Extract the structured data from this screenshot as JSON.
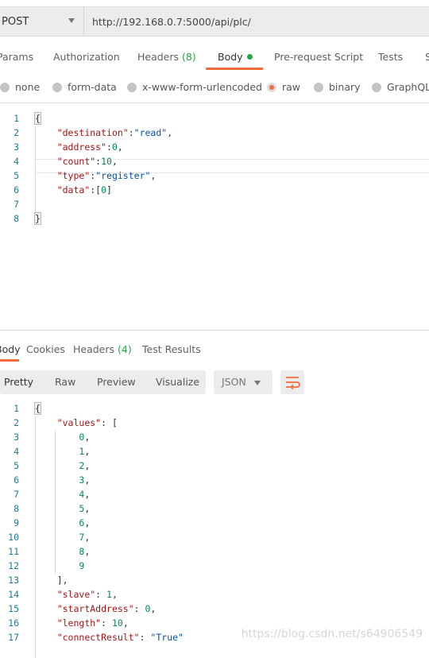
{
  "request": {
    "method": "POST",
    "url": "http://192.168.0.7:5000/api/plc/",
    "tabs": [
      {
        "label": "Params"
      },
      {
        "label": "Authorization"
      },
      {
        "label": "Headers",
        "count": "(8)"
      },
      {
        "label": "Body",
        "active": true
      },
      {
        "label": "Pre-request Script"
      },
      {
        "label": "Tests"
      },
      {
        "label": "S"
      }
    ],
    "body_types": [
      {
        "label": "none"
      },
      {
        "label": "form-data"
      },
      {
        "label": "x-www-form-urlencoded"
      },
      {
        "label": "raw",
        "selected": true
      },
      {
        "label": "binary"
      },
      {
        "label": "GraphQL"
      }
    ],
    "code_lines": [
      [
        [
          "p",
          "{"
        ]
      ],
      [
        [
          "p",
          "    "
        ],
        [
          "k",
          "\"destination\""
        ],
        [
          "p",
          ":"
        ],
        [
          "s",
          "\"read\""
        ],
        [
          "p",
          ","
        ]
      ],
      [
        [
          "p",
          "    "
        ],
        [
          "k",
          "\"address\""
        ],
        [
          "p",
          ":"
        ],
        [
          "n",
          "0"
        ],
        [
          "p",
          ","
        ]
      ],
      [
        [
          "p",
          "    "
        ],
        [
          "k",
          "\"count\""
        ],
        [
          "p",
          ":"
        ],
        [
          "n",
          "10"
        ],
        [
          "p",
          ","
        ]
      ],
      [
        [
          "p",
          "    "
        ],
        [
          "k",
          "\"type\""
        ],
        [
          "p",
          ":"
        ],
        [
          "s",
          "\"register\""
        ],
        [
          "p",
          ","
        ]
      ],
      [
        [
          "p",
          "    "
        ],
        [
          "k",
          "\"data\""
        ],
        [
          "p",
          ":["
        ],
        [
          "n",
          "0"
        ],
        [
          "p",
          "]"
        ]
      ],
      [],
      [
        [
          "p",
          "}"
        ]
      ]
    ]
  },
  "response": {
    "tabs": [
      {
        "label": "Body",
        "active": true
      },
      {
        "label": "Cookies"
      },
      {
        "label": "Headers",
        "count": "(4)"
      },
      {
        "label": "Test Results"
      }
    ],
    "view_modes": [
      "Pretty",
      "Raw",
      "Preview",
      "Visualize"
    ],
    "format": "JSON",
    "wrap_icon": "wrap-lines-icon",
    "code_lines": [
      [
        [
          "p",
          "{"
        ]
      ],
      [
        [
          "p",
          "    "
        ],
        [
          "k",
          "\"values\""
        ],
        [
          "p",
          ": ["
        ]
      ],
      [
        [
          "p",
          "        "
        ],
        [
          "n",
          "0"
        ],
        [
          "p",
          ","
        ]
      ],
      [
        [
          "p",
          "        "
        ],
        [
          "n",
          "1"
        ],
        [
          "p",
          ","
        ]
      ],
      [
        [
          "p",
          "        "
        ],
        [
          "n",
          "2"
        ],
        [
          "p",
          ","
        ]
      ],
      [
        [
          "p",
          "        "
        ],
        [
          "n",
          "3"
        ],
        [
          "p",
          ","
        ]
      ],
      [
        [
          "p",
          "        "
        ],
        [
          "n",
          "4"
        ],
        [
          "p",
          ","
        ]
      ],
      [
        [
          "p",
          "        "
        ],
        [
          "n",
          "5"
        ],
        [
          "p",
          ","
        ]
      ],
      [
        [
          "p",
          "        "
        ],
        [
          "n",
          "6"
        ],
        [
          "p",
          ","
        ]
      ],
      [
        [
          "p",
          "        "
        ],
        [
          "n",
          "7"
        ],
        [
          "p",
          ","
        ]
      ],
      [
        [
          "p",
          "        "
        ],
        [
          "n",
          "8"
        ],
        [
          "p",
          ","
        ]
      ],
      [
        [
          "p",
          "        "
        ],
        [
          "n",
          "9"
        ]
      ],
      [
        [
          "p",
          "    ],"
        ]
      ],
      [
        [
          "p",
          "    "
        ],
        [
          "k",
          "\"slave\""
        ],
        [
          "p",
          ": "
        ],
        [
          "n",
          "1"
        ],
        [
          "p",
          ","
        ]
      ],
      [
        [
          "p",
          "    "
        ],
        [
          "k",
          "\"startAddress\""
        ],
        [
          "p",
          ": "
        ],
        [
          "n",
          "0"
        ],
        [
          "p",
          ","
        ]
      ],
      [
        [
          "p",
          "    "
        ],
        [
          "k",
          "\"length\""
        ],
        [
          "p",
          ": "
        ],
        [
          "n",
          "10"
        ],
        [
          "p",
          ","
        ]
      ],
      [
        [
          "p",
          "    "
        ],
        [
          "k",
          "\"connectResult\""
        ],
        [
          "p",
          ": "
        ],
        [
          "s",
          "\"True\""
        ]
      ]
    ]
  },
  "watermark": "https://blog.csdn.net/s64906549",
  "colors": {
    "accent": "#f26b3a",
    "green": "#26a845",
    "key": "#a31515",
    "string": "#0451a5",
    "number": "#098658"
  }
}
